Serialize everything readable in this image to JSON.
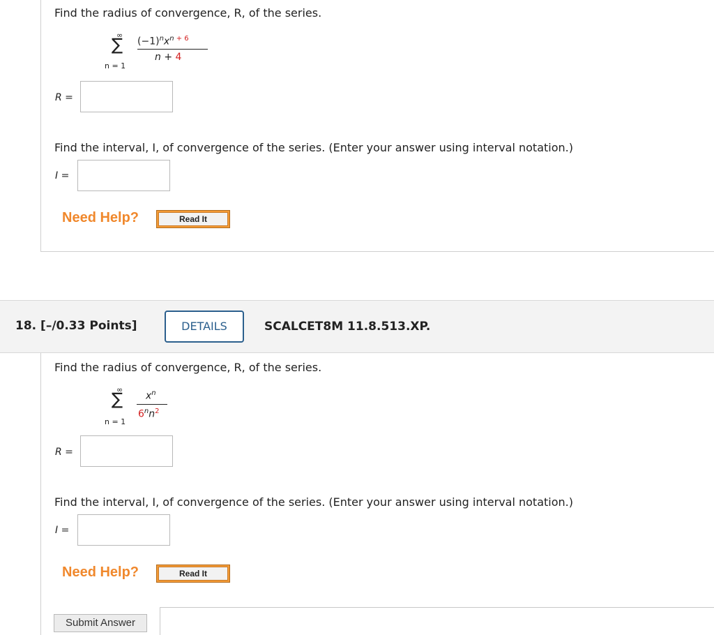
{
  "q17": {
    "radius_prompt": "Find the radius of convergence, R, of the series.",
    "series": {
      "sum_upper": "∞",
      "sum_lower": "n = 1",
      "numerator_black": "(−1)",
      "numerator_n_sup": "n",
      "numerator_x": "x",
      "numerator_exp_n": "n",
      "numerator_exp_red": " + 6",
      "denominator_black": "n + ",
      "denominator_red": "4"
    },
    "r_label": "R =",
    "interval_prompt": "Find the interval, I, of convergence of the series. (Enter your answer using interval notation.)",
    "i_label": "I =",
    "need_help": "Need Help?",
    "read_it": "Read It"
  },
  "q18": {
    "number": "18.",
    "points": "[–/0.33 Points]",
    "details_button": "DETAILS",
    "assignment_code": "SCALCET8M 11.8.513.XP.",
    "radius_prompt": "Find the radius of convergence, R, of the series.",
    "series": {
      "sum_upper": "∞",
      "sum_lower": "n = 1",
      "numerator_x": "x",
      "numerator_exp": "n",
      "denominator_red": "6",
      "denominator_exp_n": "n",
      "denominator_n": "n",
      "denominator_exp_red": "2"
    },
    "r_label": "R =",
    "interval_prompt": "Find the interval, I, of convergence of the series. (Enter your answer using interval notation.)",
    "i_label": "I =",
    "need_help": "Need Help?",
    "read_it": "Read It",
    "submit_button": "Submit Answer"
  },
  "colors": {
    "need_help": "#f0882c",
    "details_border": "#2b5f8d",
    "math_red": "#d21f1f"
  }
}
